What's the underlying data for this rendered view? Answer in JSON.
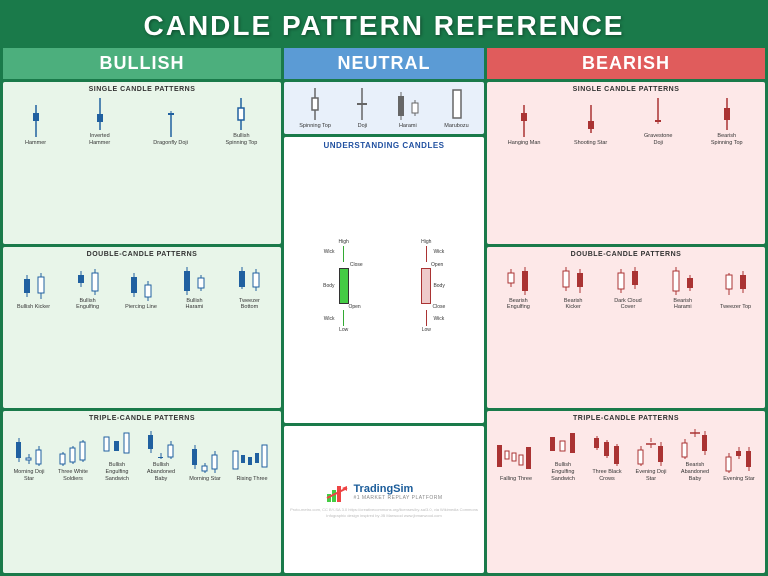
{
  "header": {
    "title": "CANDLE PATTERN REFERENCE"
  },
  "sections": {
    "bullish": {
      "label": "BULLISH",
      "single_title": "SINGLE CANDLE PATTERNS",
      "double_title": "DOUBLE-CANDLE PATTERNS",
      "triple_title": "TRIPLE-CANDLE PATTERNS",
      "single_patterns": [
        {
          "name": "Hammer"
        },
        {
          "name": "Inverted\nHammer"
        },
        {
          "name": "Dragonfly\nDoji"
        },
        {
          "name": "Bullish\nSpinning Top"
        }
      ],
      "double_patterns": [
        {
          "name": "Bullish\nKicker"
        },
        {
          "name": "Bullish\nEngulfing"
        },
        {
          "name": "Piercing\nLine"
        },
        {
          "name": "Bullish\nHarami"
        },
        {
          "name": "Tweezer\nBottom"
        }
      ],
      "triple_patterns": [
        {
          "name": "Morning\nDoji Star"
        },
        {
          "name": "Three White\nSoldiers"
        },
        {
          "name": "Bullish\nEngulfing\nSandwich"
        },
        {
          "name": "Bullish\nAbandoned\nBaby"
        },
        {
          "name": "Morning\nStar"
        },
        {
          "name": "Rising\nThree"
        }
      ]
    },
    "neutral": {
      "label": "NEUTRAL",
      "single_patterns": [
        {
          "name": "Spinning\nTop"
        },
        {
          "name": "Doji"
        },
        {
          "name": "Harami"
        },
        {
          "name": "Marubozu"
        }
      ],
      "understanding_title": "UNDERSTANDING CANDLES"
    },
    "bearish": {
      "label": "BEARISH",
      "single_title": "SINGLE CANDLE PATTERNS",
      "double_title": "DOUBLE-CANDLE PATTERNS",
      "triple_title": "TRIPLE-CANDLE PATTERNS",
      "single_patterns": [
        {
          "name": "Hanging Man"
        },
        {
          "name": "Shooting Star"
        },
        {
          "name": "Gravestone Doji"
        },
        {
          "name": "Bearish\nSpinning Top"
        }
      ],
      "double_patterns": [
        {
          "name": "Bearish\nEngulfing"
        },
        {
          "name": "Bearish\nKicker"
        },
        {
          "name": "Dark Cloud\nCover"
        },
        {
          "name": "Bearish\nHarami"
        },
        {
          "name": "Tweezer\nTop"
        }
      ],
      "triple_patterns": [
        {
          "name": "Falling\nThree"
        },
        {
          "name": "Bullish\nEngulfing\nSandwich"
        },
        {
          "name": "Three Black\nCrows"
        },
        {
          "name": "Evening\nDoji Star"
        },
        {
          "name": "Bearish\nAbandoned\nBaby"
        },
        {
          "name": "Evening\nStar"
        }
      ]
    }
  },
  "footer": {
    "logo_text": "TradingSim",
    "tagline": "#1 MARKET REPLAY PLATFORM",
    "credits": "Proto-metro.com, CC BY-SA 3.0 https://creativecommons.org/licenses/by-sa/3.0, via Wikimedia Commons    Infographic design inspired by JB Marwood www.jbmarwood.com"
  }
}
